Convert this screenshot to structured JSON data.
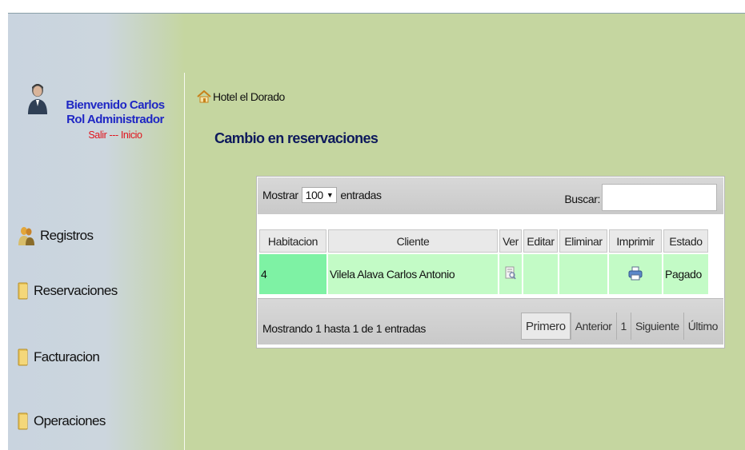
{
  "sidebar": {
    "welcome": "Bienvenido Carlos",
    "role": "Rol Administrador",
    "logout_link": "Salir",
    "link_separator": " --- ",
    "home_link": "Inicio",
    "menu": [
      {
        "label": "Registros",
        "icon": "users-icon"
      },
      {
        "label": "Reservaciones",
        "icon": "folder-icon"
      },
      {
        "label": "Facturacion",
        "icon": "folder-icon"
      },
      {
        "label": "Operaciones",
        "icon": "folder-icon"
      }
    ]
  },
  "breadcrumb": {
    "home": "Hotel el Dorado",
    "icon": "home-icon"
  },
  "page_title": "Cambio en reservaciones",
  "table": {
    "length_label_before": "Mostrar",
    "length_value": "100",
    "length_label_after": "entradas",
    "search_label": "Buscar:",
    "search_value": "",
    "columns": [
      "Habitacion",
      "Cliente",
      "Ver",
      "Editar",
      "Eliminar",
      "Imprimir",
      "Estado"
    ],
    "rows": [
      {
        "habitacion": "4",
        "cliente": "Vilela Alava Carlos Antonio",
        "ver": "view-icon",
        "editar": "",
        "eliminar": "",
        "imprimir": "print-icon",
        "estado": "Pagado"
      }
    ],
    "info": "Mostrando 1 hasta 1 de 1 entradas",
    "pagination": {
      "first": "Primero",
      "previous": "Anterior",
      "page": "1",
      "next": "Siguiente",
      "last": "Último"
    }
  },
  "colors": {
    "page_bg": "#c5d6a0",
    "accent_blue": "#1f27c4",
    "link_red": "#e0141c",
    "row_bg": "#c3fbc6",
    "room_cell": "#7ef2a4",
    "title": "#0e1a5c"
  }
}
